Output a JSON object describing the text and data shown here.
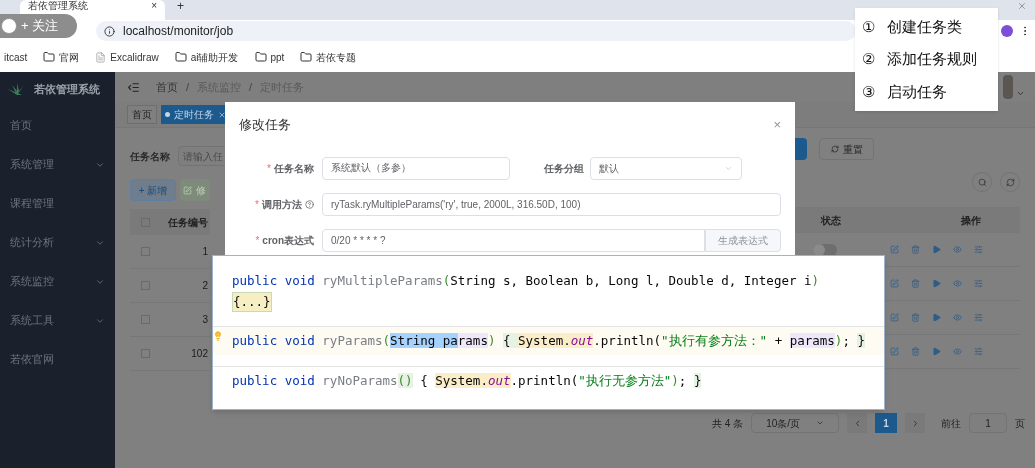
{
  "browser": {
    "tab_title": "若依管理系统",
    "tab_close": "×",
    "new_tab": "+",
    "url": "localhost/monitor/job",
    "bookmarks": [
      {
        "label": "itcast",
        "kind": "plain"
      },
      {
        "label": "官网",
        "kind": "folder"
      },
      {
        "label": "Excalidraw",
        "kind": "page"
      },
      {
        "label": "ai辅助开发",
        "kind": "folder"
      },
      {
        "label": "ppt",
        "kind": "folder"
      },
      {
        "label": "若依专题",
        "kind": "folder"
      }
    ]
  },
  "follow_badge": {
    "label": "+ 关注"
  },
  "sidebar": {
    "title": "若依管理系统",
    "items": [
      {
        "label": "首页",
        "expandable": false
      },
      {
        "label": "系统管理",
        "expandable": true
      },
      {
        "label": "课程管理",
        "expandable": false
      },
      {
        "label": "统计分析",
        "expandable": true
      },
      {
        "label": "系统监控",
        "expandable": true
      },
      {
        "label": "系统工具",
        "expandable": true
      },
      {
        "label": "若依官网",
        "expandable": false
      }
    ]
  },
  "header": {
    "breadcrumb": [
      "首页",
      "系统监控",
      "定时任务"
    ],
    "separator": "/"
  },
  "tags": [
    {
      "label": "首页",
      "selected": false
    },
    {
      "label": "定时任务",
      "selected": true
    }
  ],
  "search_form": {
    "label": "任务名称",
    "placeholder": "请输入任",
    "reset": "重置"
  },
  "toolbar": {
    "add": "+ 新增",
    "edit": "修"
  },
  "table": {
    "all_checked": false,
    "columns": [
      "任务编号",
      "状态",
      "操作"
    ],
    "rows": [
      {
        "id": "1",
        "checked": false,
        "switch": {
          "on": false
        }
      },
      {
        "id": "2",
        "checked": false
      },
      {
        "id": "3",
        "checked": false
      },
      {
        "id": "102",
        "checked": false
      }
    ]
  },
  "pagination": {
    "total": "共 4 条",
    "page_size": "10条/页",
    "pages": [
      {
        "label": "1",
        "selected": true
      }
    ],
    "goto_label": "前往",
    "goto_value": "1",
    "suffix": "页"
  },
  "dialog": {
    "title": "修改任务",
    "close": "×",
    "fields": [
      {
        "label": "任务名称",
        "mark": "*",
        "value": "系统默认（多参）",
        "help": false
      },
      {
        "label": "任务分组",
        "value": "默认",
        "help": false
      },
      {
        "label": "调用方法",
        "mark": "*",
        "value": "ryTask.ryMultipleParams('ry', true, 2000L, 316.50D, 100)",
        "help": true
      },
      {
        "label": "cron表达式",
        "mark": "*",
        "value": "0/20 * * * * ?",
        "help": false,
        "button": "生成表达式"
      }
    ]
  },
  "code_popup": {
    "lines": [
      {
        "current": false,
        "fold": "{...}",
        "tokens": [
          {
            "text": "public ",
            "kind": "keyword"
          },
          {
            "text": "void ",
            "kind": "keyword"
          },
          {
            "text": "ryMultipleParams",
            "kind": "method"
          },
          {
            "text": "(",
            "kind": "paren"
          },
          {
            "text": "String s, Boolean b, Long l, Double d, Integer i",
            "kind": "plain"
          },
          {
            "text": ")",
            "kind": "paren"
          }
        ]
      },
      {
        "current": true,
        "tokens": [
          {
            "text": "public ",
            "kind": "keyword"
          },
          {
            "text": "void ",
            "kind": "keyword"
          },
          {
            "text": "ryParams",
            "kind": "method"
          },
          {
            "text": "(",
            "kind": "paren"
          },
          {
            "text": "String pa",
            "kind": "plain",
            "color": "#a6d2ff"
          },
          {
            "text": "rams",
            "kind": "plain",
            "color": "#ede7fa"
          },
          {
            "text": ") ",
            "kind": "paren"
          },
          {
            "text": "{ ",
            "kind": "plain",
            "color": "#e6f3e4"
          },
          {
            "text": "System.",
            "kind": "plain",
            "color": "#fbedc8"
          },
          {
            "text": "out",
            "kind": "field",
            "color": "#fbedc8"
          },
          {
            "text": ".println(",
            "kind": "plain"
          },
          {
            "text": "\"执行有参方法：\"",
            "kind": "string"
          },
          {
            "text": " + ",
            "kind": "plain"
          },
          {
            "text": "params",
            "kind": "plain",
            "color": "#ede7fa"
          },
          {
            "text": ")",
            "kind": "paren"
          },
          {
            "text": "; ",
            "kind": "plain"
          },
          {
            "text": "}",
            "kind": "plain",
            "color": "#e6f3e4"
          }
        ]
      },
      {
        "current": false,
        "tokens": [
          {
            "text": "public ",
            "kind": "keyword"
          },
          {
            "text": "void ",
            "kind": "keyword"
          },
          {
            "text": "ryNoParams",
            "kind": "method"
          },
          {
            "text": "()",
            "kind": "paren",
            "color": "#e6f3e4"
          },
          {
            "text": " { ",
            "kind": "plain"
          },
          {
            "text": "System.",
            "kind": "plain",
            "color": "#fbedc8"
          },
          {
            "text": "out",
            "kind": "field",
            "color": "#fbedc8"
          },
          {
            "text": ".println(",
            "kind": "plain"
          },
          {
            "text": "\"执行无参方法\"",
            "kind": "string"
          },
          {
            "text": ")",
            "kind": "paren"
          },
          {
            "text": "; ",
            "kind": "plain"
          },
          {
            "text": "}",
            "kind": "plain",
            "color": "#e6f3e4"
          }
        ]
      }
    ]
  },
  "steps": [
    {
      "number": "①",
      "label": "创建任务类"
    },
    {
      "number": "②",
      "label": "添加任务规则"
    },
    {
      "number": "③",
      "label": "启动任务"
    }
  ]
}
